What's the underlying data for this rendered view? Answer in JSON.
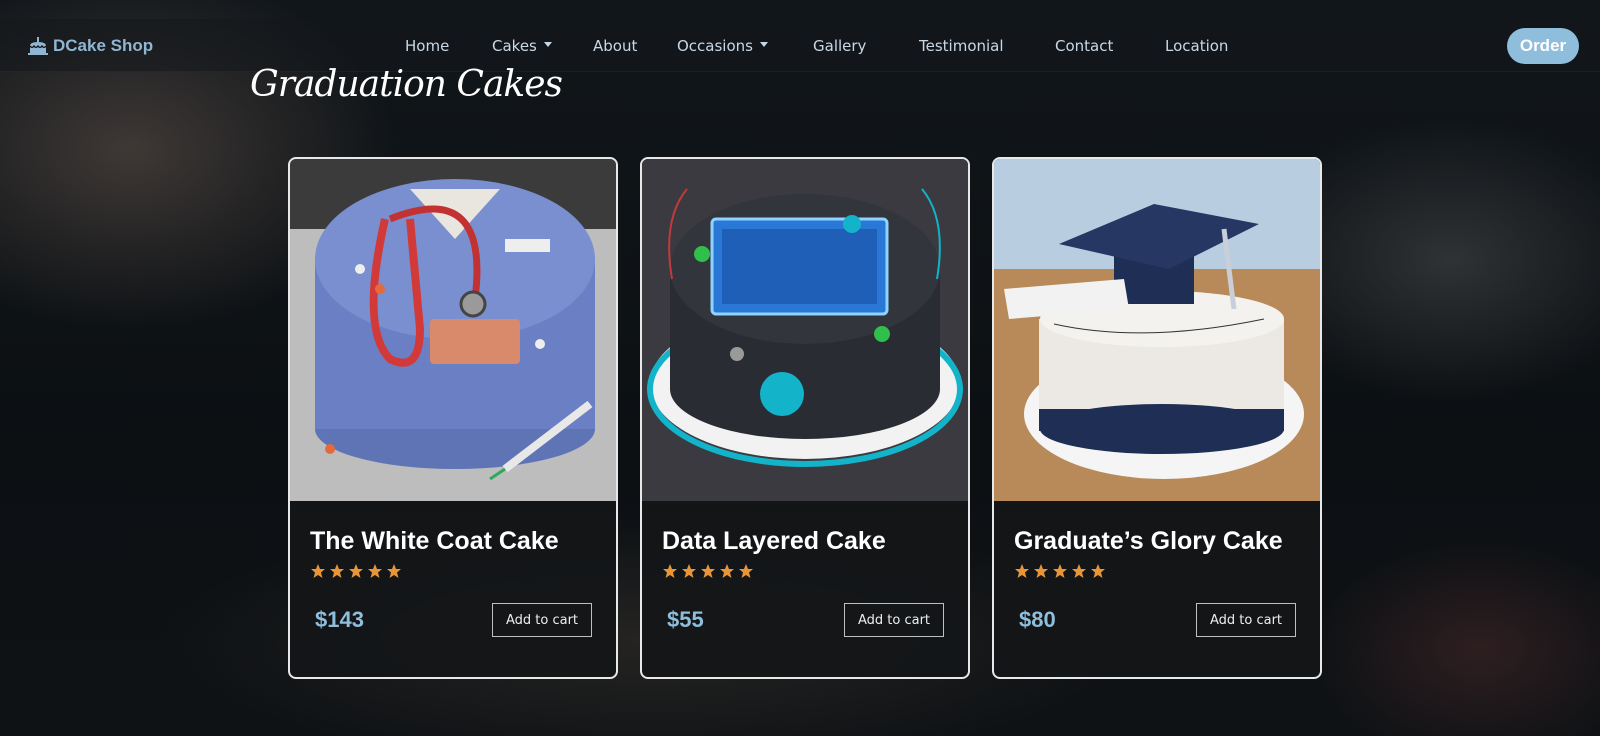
{
  "brand": {
    "name": "DCake Shop",
    "icon": "cake-icon"
  },
  "nav": {
    "items": [
      {
        "label": "Home"
      },
      {
        "label": "Cakes",
        "dropdown": true
      },
      {
        "label": "About"
      },
      {
        "label": "Occasions",
        "dropdown": true
      },
      {
        "label": "Gallery"
      },
      {
        "label": "Testimonial"
      },
      {
        "label": "Contact"
      },
      {
        "label": "Location"
      }
    ],
    "order_label": "Order"
  },
  "heading": "Graduation Cakes",
  "products": [
    {
      "title": "The White Coat Cake",
      "price": "$143",
      "rating": 5,
      "cart_label": "Add to cart"
    },
    {
      "title": "Data Layered Cake",
      "price": "$55",
      "rating": 5,
      "cart_label": "Add to cart"
    },
    {
      "title": "Graduate’s Glory Cake",
      "price": "$80",
      "rating": 5,
      "cart_label": "Add to cart"
    }
  ],
  "colors": {
    "accent": "#8fbedc",
    "star": "#e8953a"
  }
}
